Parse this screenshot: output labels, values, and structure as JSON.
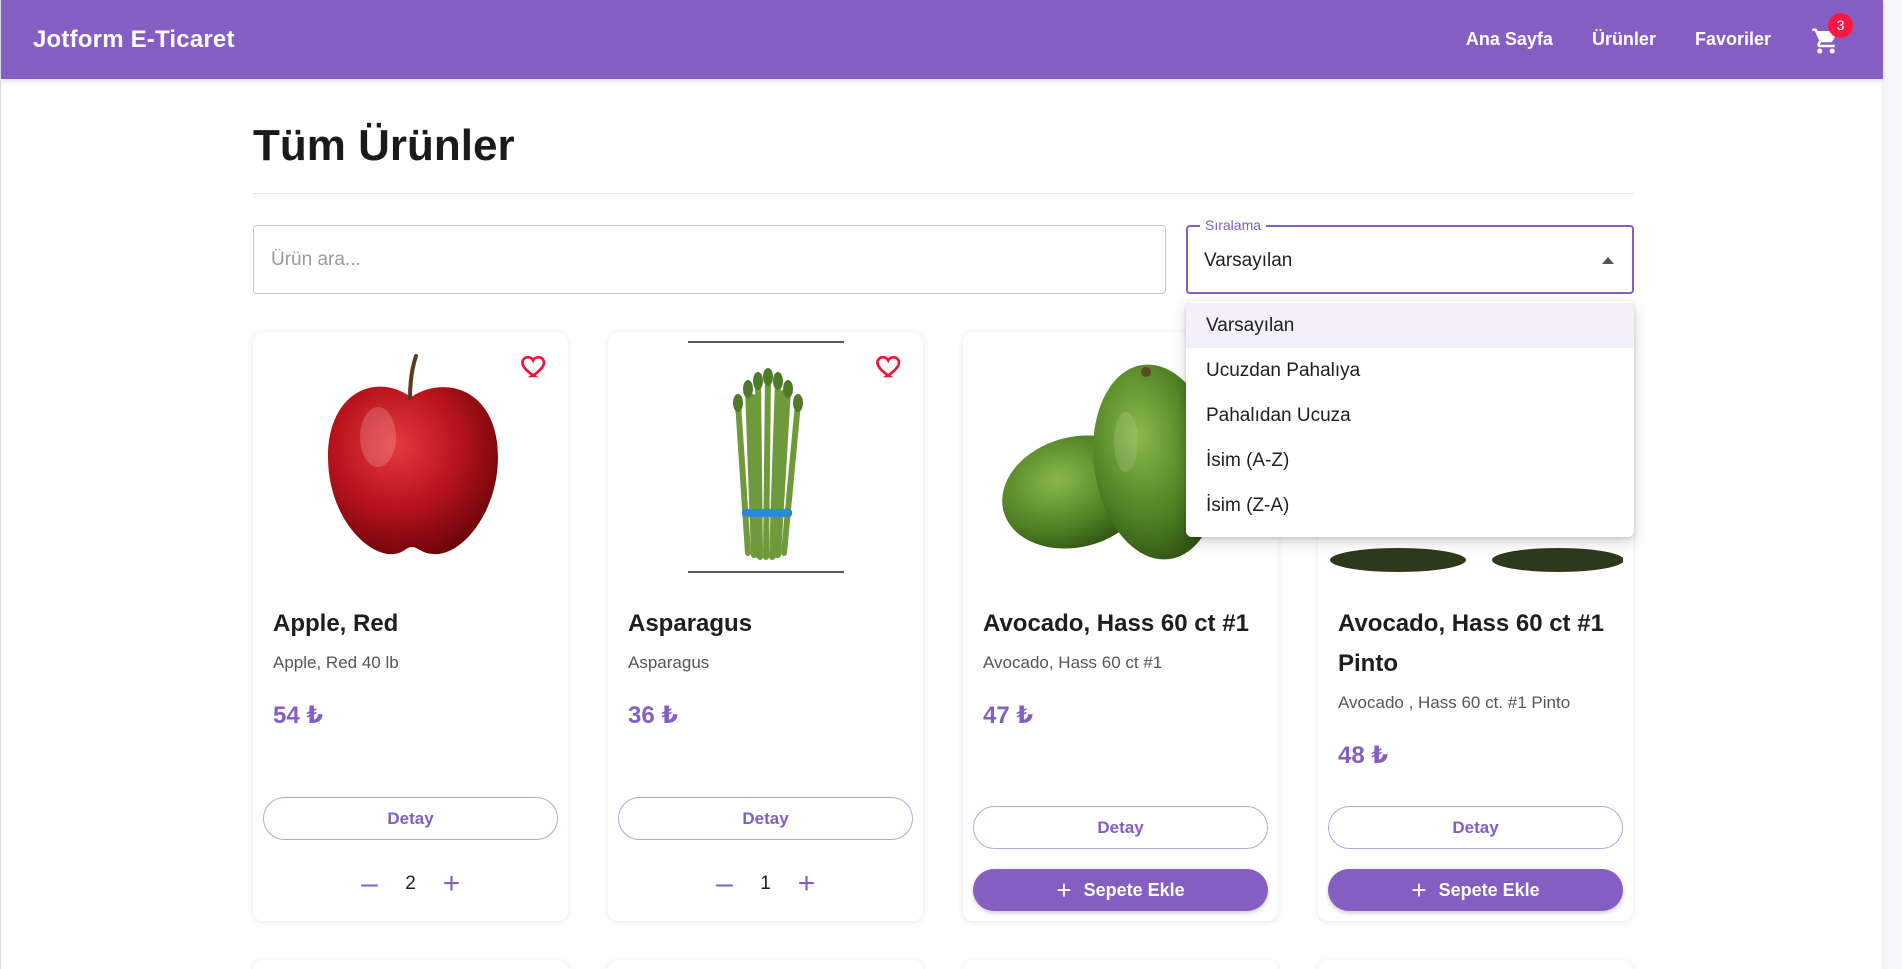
{
  "header": {
    "brand": "Jotform E-Ticaret",
    "nav": [
      "Ana Sayfa",
      "Ürünler",
      "Favoriler"
    ],
    "cart_count": "3"
  },
  "page": {
    "title": "Tüm Ürünler",
    "search_placeholder": "Ürün ara...",
    "sort_label": "Sıralama",
    "sort_value": "Varsayılan",
    "sort_options": [
      "Varsayılan",
      "Ucuzdan Pahalıya",
      "Pahalıdan Ucuza",
      "İsim (A-Z)",
      "İsim (Z-A)"
    ]
  },
  "products": [
    {
      "name": "Apple, Red",
      "desc": "Apple, Red 40 lb",
      "price": "54 ₺",
      "detail": "Detay",
      "qty": "2"
    },
    {
      "name": "Asparagus",
      "desc": "Asparagus",
      "price": "36 ₺",
      "detail": "Detay",
      "qty": "1"
    },
    {
      "name": "Avocado, Hass 60 ct #1",
      "desc": "Avocado, Hass 60 ct #1",
      "price": "47 ₺",
      "detail": "Detay",
      "add": "Sepete Ekle"
    },
    {
      "name": "Avocado, Hass 60 ct #1 Pinto",
      "desc": "Avocado , Hass 60 ct. #1 Pinto",
      "price": "48 ₺",
      "detail": "Detay",
      "add": "Sepete Ekle"
    }
  ],
  "colors": {
    "primary": "#845ec2",
    "badge": "#ff1744",
    "heart": "#e8173f"
  },
  "icons": {
    "cart": "shopping-cart-icon",
    "favorite": "heart-outline-icon",
    "add": "plus-icon",
    "decrease": "minus-icon",
    "increase": "plus-icon"
  }
}
